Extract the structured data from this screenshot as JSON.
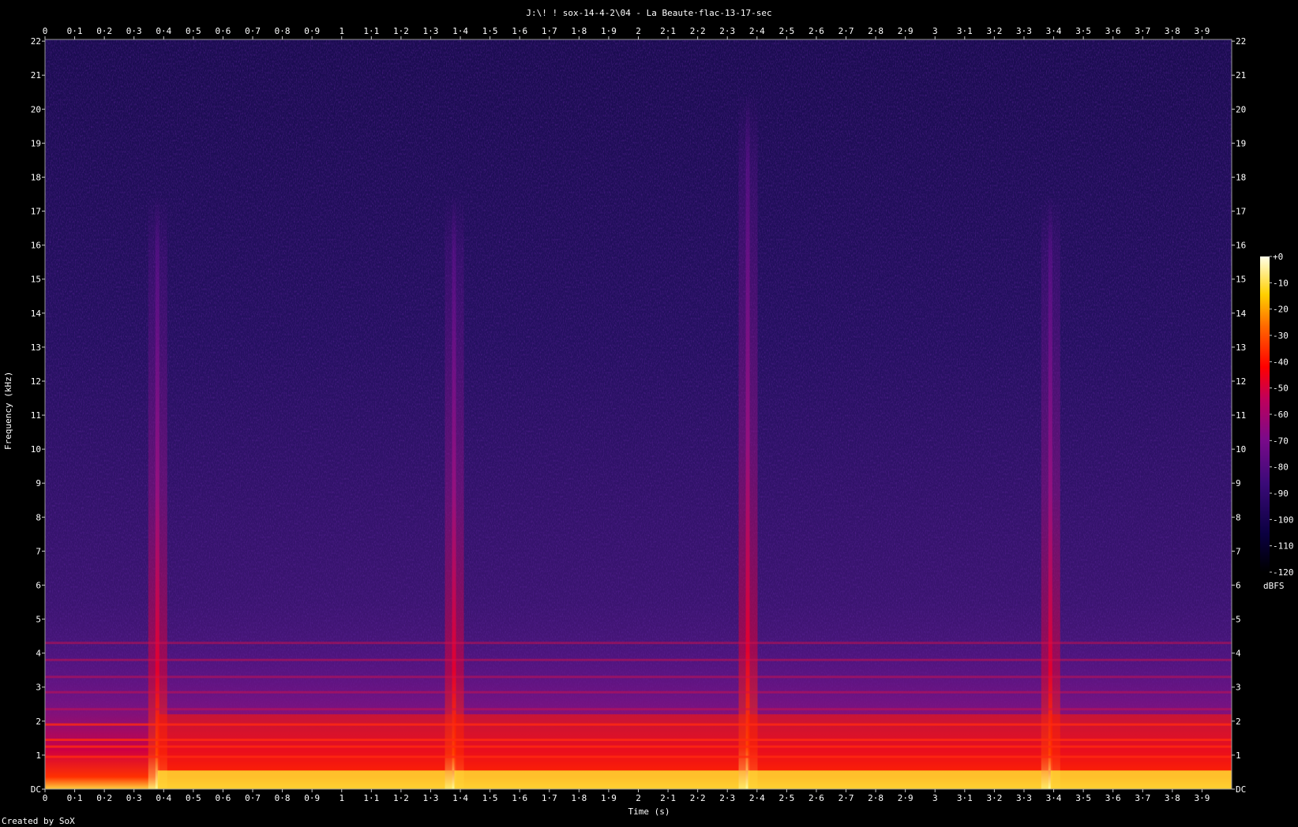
{
  "chart_data": {
    "type": "heatmap",
    "title": "J:\\! ! sox-14-4-2\\04 - La Beaute·flac-13-17-sec",
    "xlabel": "Time (s)",
    "ylabel": "Frequency (kHz)",
    "xlim": [
      0,
      4.0
    ],
    "ylim": [
      0,
      22.05
    ],
    "x_ticks": [
      "0",
      "0·1",
      "0·2",
      "0·3",
      "0·4",
      "0·5",
      "0·6",
      "0·7",
      "0·8",
      "0·9",
      "1",
      "1·1",
      "1·2",
      "1·3",
      "1·4",
      "1·5",
      "1·6",
      "1·7",
      "1·8",
      "1·9",
      "2",
      "2·1",
      "2·2",
      "2·3",
      "2·4",
      "2·5",
      "2·6",
      "2·7",
      "2·8",
      "2·9",
      "3",
      "3·1",
      "3·2",
      "3·3",
      "3·4",
      "3·5",
      "3·6",
      "3·7",
      "3·8",
      "3·9"
    ],
    "y_ticks": [
      "DC",
      "1",
      "2",
      "3",
      "4",
      "5",
      "6",
      "7",
      "8",
      "9",
      "10",
      "11",
      "12",
      "13",
      "14",
      "15",
      "16",
      "17",
      "18",
      "19",
      "20",
      "21",
      "22"
    ],
    "colorbar": {
      "label": "dBFS",
      "range": [
        -120,
        0
      ],
      "ticks": [
        "+0",
        "-10",
        "-20",
        "-30",
        "-40",
        "-50",
        "-60",
        "-70",
        "-80",
        "-90",
        "-100",
        "-110",
        "-120"
      ]
    },
    "onsets_s": [
      0.38,
      1.38,
      2.37,
      3.39
    ],
    "credit": "Created by SoX",
    "colors": {
      "background": "#000000",
      "low": "#0a0028",
      "mid": "#5a0a8a",
      "high": "#ff1a00",
      "peak": "#ffffa0"
    }
  }
}
